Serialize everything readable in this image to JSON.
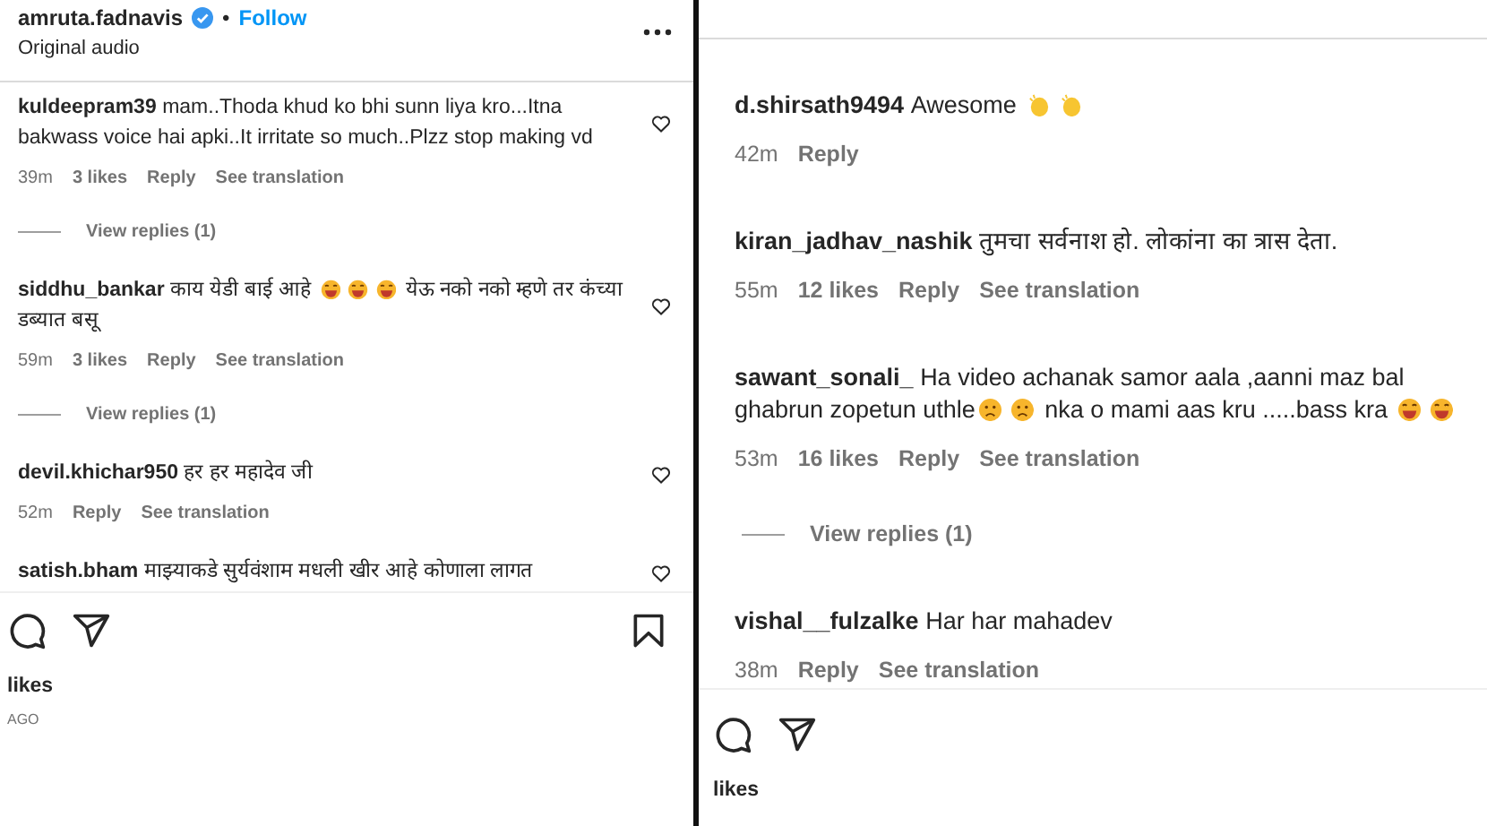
{
  "panels": [
    {
      "header": {
        "username": "amruta.fadnavis",
        "verified": true,
        "separator": "•",
        "follow": "Follow",
        "subtitle": "Original audio"
      },
      "comments": [
        {
          "username": "kuldeepram39",
          "parts": [
            {
              "kind": "text",
              "text": "mam..Thoda khud ko bhi sunn liya kro...Itna bakwass voice hai apki..It irritate so much..Plzz stop making vd"
            }
          ],
          "time": "39m",
          "likes": "3 likes",
          "reply": "Reply",
          "translate": "See translation",
          "view_replies": "View replies (1)",
          "heart": true
        },
        {
          "username": "siddhu_bankar",
          "parts": [
            {
              "kind": "text",
              "text": "काय येडी बाई आहे "
            },
            {
              "kind": "laugh"
            },
            {
              "kind": "laugh"
            },
            {
              "kind": "laugh"
            },
            {
              "kind": "text",
              "text": " येऊ नको नको म्हणे तर कंच्या डब्यात बसू"
            }
          ],
          "time": "59m",
          "likes": "3 likes",
          "reply": "Reply",
          "translate": "See translation",
          "view_replies": "View replies (1)",
          "heart": true
        },
        {
          "username": "devil.khichar950",
          "parts": [
            {
              "kind": "text",
              "text": "हर हर महादेव जी"
            }
          ],
          "time": "52m",
          "reply": "Reply",
          "translate": "See translation",
          "heart": true
        },
        {
          "username": "satish.bham",
          "parts": [
            {
              "kind": "text",
              "text": "माझ्याकडे सुर्यवंशाम मधली खीर आहे कोणाला लागत"
            }
          ],
          "heart": true
        }
      ],
      "actions": {
        "bookmark": true
      },
      "likes": "likes",
      "time_ago": "AGO"
    },
    {
      "comments": [
        {
          "username": "d.shirsath9494",
          "parts": [
            {
              "kind": "text",
              "text": "Awesome "
            },
            {
              "kind": "clap"
            },
            {
              "kind": "clap"
            }
          ],
          "time": "42m",
          "reply": "Reply"
        },
        {
          "username": "kiran_jadhav_nashik",
          "parts": [
            {
              "kind": "text",
              "text": "तुमचा सर्वनाश हो. लोकांना का त्रास देता."
            }
          ],
          "time": "55m",
          "likes": "12 likes",
          "reply": "Reply",
          "translate": "See translation"
        },
        {
          "username": "sawant_sonali_",
          "parts": [
            {
              "kind": "text",
              "text": "Ha video achanak samor aala ,aanni maz bal ghabrun zopetun uthle"
            },
            {
              "kind": "sad"
            },
            {
              "kind": "sad"
            },
            {
              "kind": "text",
              "text": " nka o mami aas kru .....bass kra "
            },
            {
              "kind": "laugh"
            },
            {
              "kind": "laugh"
            }
          ],
          "time": "53m",
          "likes": "16 likes",
          "reply": "Reply",
          "translate": "See translation",
          "view_replies": "View replies (1)"
        },
        {
          "username": "vishal__fulzalke",
          "parts": [
            {
              "kind": "text",
              "text": "Har har mahadev"
            }
          ],
          "time": "38m",
          "reply": "Reply",
          "translate": "See translation"
        }
      ],
      "likes": "likes"
    }
  ]
}
